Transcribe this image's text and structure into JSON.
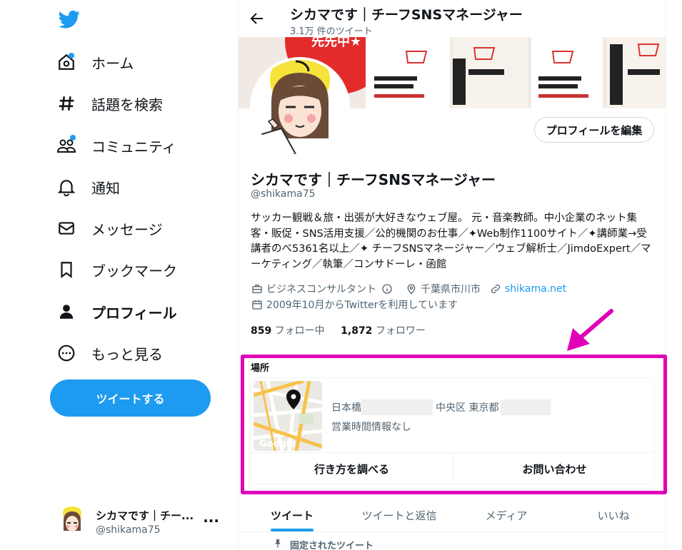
{
  "sidebar": {
    "items": [
      {
        "label": "ホーム"
      },
      {
        "label": "話題を検索"
      },
      {
        "label": "コミュニティ"
      },
      {
        "label": "通知"
      },
      {
        "label": "メッセージ"
      },
      {
        "label": "ブックマーク"
      },
      {
        "label": "プロフィール"
      },
      {
        "label": "もっと見る"
      }
    ],
    "tweet_button": "ツイートする",
    "account": {
      "name": "シカマです｜チー...",
      "handle": "@shikama75",
      "more": "···"
    }
  },
  "header": {
    "title": "シカマです｜チーフSNSマネージャー",
    "subtitle": "3.1万 件のツイート"
  },
  "profile": {
    "edit_button": "プロフィールを編集",
    "name": "シカマです｜チーフSNSマネージャー",
    "handle": "@shikama75",
    "bio_lines": [
      "サッカー観戦＆旅・出張が大好きなウェブ屋。 元・音楽教師。中小企業のネット集",
      "客・販促・SNS活用支援／公的機関のお仕事／✦Web制作1100サイト／✦講師業→受",
      "講者のべ5361名以上／✦ チーフSNSマネージャー／ウェブ解析士／JimdoExpert／マ",
      "ーケティング／執筆／コンサドーレ・函館"
    ],
    "category": "ビジネスコンサルタント",
    "location": "千葉県市川市",
    "website": "shikama.net",
    "joined": "2009年10月からTwitterを利用しています",
    "following_count": "859",
    "following_label": "フォロー中",
    "followers_count": "1,872",
    "followers_label": "フォロワー"
  },
  "location_card": {
    "title": "場所",
    "address_part1": "日本橋",
    "address_part2": "中央区 東京都",
    "hours": "営業時間情報なし",
    "map_logo": "Google",
    "directions_button": "行き方を調べる",
    "contact_button": "お問い合わせ"
  },
  "banner": {
    "badge_text": "先先中★"
  },
  "tabs": [
    {
      "label": "ツイート",
      "active": true
    },
    {
      "label": "ツイートと返信",
      "active": false
    },
    {
      "label": "メディア",
      "active": false
    },
    {
      "label": "いいね",
      "active": false
    }
  ],
  "pinned_label": "固定されたツイート",
  "colors": {
    "accent": "#1d9bf0",
    "highlight": "#e000b8",
    "text": "#0f1419",
    "muted": "#536471"
  }
}
